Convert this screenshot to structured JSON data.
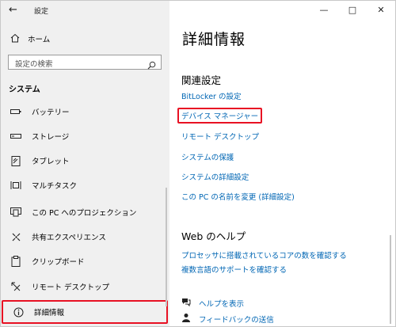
{
  "titlebar": {
    "back_glyph": "←",
    "title": "設定",
    "minimize": "—",
    "maximize": "□",
    "close": "✕"
  },
  "sidebar": {
    "home_label": "ホーム",
    "search_placeholder": "設定の検索",
    "section": "システム",
    "items": [
      {
        "label": "バッテリー",
        "icon": "battery-icon"
      },
      {
        "label": "ストレージ",
        "icon": "storage-icon"
      },
      {
        "label": "タブレット",
        "icon": "tablet-icon"
      },
      {
        "label": "マルチタスク",
        "icon": "multitask-icon"
      },
      {
        "label": "この PC へのプロジェクション",
        "icon": "projection-icon"
      },
      {
        "label": "共有エクスペリエンス",
        "icon": "shared-experience-icon"
      },
      {
        "label": "クリップボード",
        "icon": "clipboard-icon"
      },
      {
        "label": "リモート デスクトップ",
        "icon": "remote-desktop-icon"
      },
      {
        "label": "詳細情報",
        "icon": "info-icon",
        "selected": true
      }
    ]
  },
  "main": {
    "title": "詳細情報",
    "related_heading": "関連設定",
    "related_links": [
      "BitLocker の設定",
      "デバイス マネージャー",
      "リモート デスクトップ",
      "システムの保護",
      "システムの詳細設定",
      "この PC の名前を変更 (詳細設定)"
    ],
    "web_help_heading": "Web のヘルプ",
    "web_help_links": [
      "プロセッサに搭載されているコアの数を確認する",
      "複数言語のサポートを確認する"
    ],
    "help_actions": [
      {
        "label": "ヘルプを表示",
        "icon": "help-chat-icon"
      },
      {
        "label": "フィードバックの送信",
        "icon": "feedback-icon"
      }
    ],
    "highlight_color": "#e81123",
    "link_color": "#0066b4"
  }
}
